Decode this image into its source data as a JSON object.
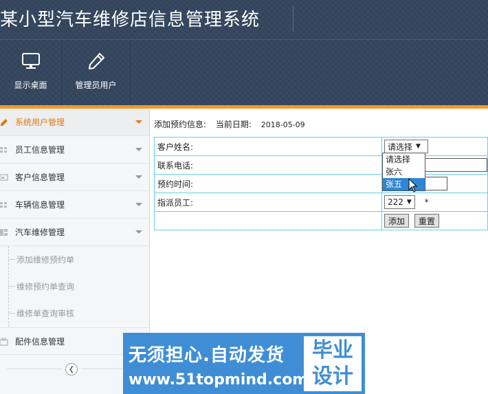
{
  "header": {
    "title": "某小型汽车维修店信息管理系统",
    "toolbar": [
      {
        "label": "显示桌面",
        "icon": "monitor-icon"
      },
      {
        "label": "管理员用户",
        "icon": "pencil-icon"
      }
    ]
  },
  "sidebar": {
    "items": [
      {
        "label": "系统用户管理",
        "icon": "pencil-icon",
        "active": true
      },
      {
        "label": "员工信息管理",
        "icon": "grid-icon"
      },
      {
        "label": "客户信息管理",
        "icon": "card-icon"
      },
      {
        "label": "车辆信息管理",
        "icon": "grid-icon"
      },
      {
        "label": "汽车维修管理",
        "icon": "grid-icon",
        "expanded": true
      },
      {
        "label": "配件信息管理",
        "icon": "box-icon"
      }
    ],
    "subitems": [
      {
        "label": "添加维修预约单"
      },
      {
        "label": "维修预约单查询"
      },
      {
        "label": "维修单查询审核"
      }
    ]
  },
  "main": {
    "info_label": "添加预约信息:",
    "date_label": "当前日期:",
    "date_value": "2018-05-09",
    "form": {
      "customer_label": "客户姓名:",
      "customer_select": "请选择",
      "phone_label": "联系电话:",
      "time_label": "预约时间:",
      "staff_label": "指派员工:",
      "staff_select": "222",
      "required_mark": "*",
      "add_button": "添加",
      "reset_button": "重置"
    },
    "dropdown_options": [
      "请选择",
      "张六",
      "张五"
    ],
    "dropdown_selected": "张五"
  },
  "watermark": {
    "line1": "无须担心.自动发货",
    "line2": "www.51topmind.com",
    "badge1": "毕业",
    "badge2": "设计"
  },
  "colors": {
    "header_bg": "#35475f",
    "accent_orange": "#f39a2c",
    "table_border": "#68cfe2",
    "dropdown_highlight": "#2d86d6",
    "watermark_bg": "#3f8ed5"
  }
}
